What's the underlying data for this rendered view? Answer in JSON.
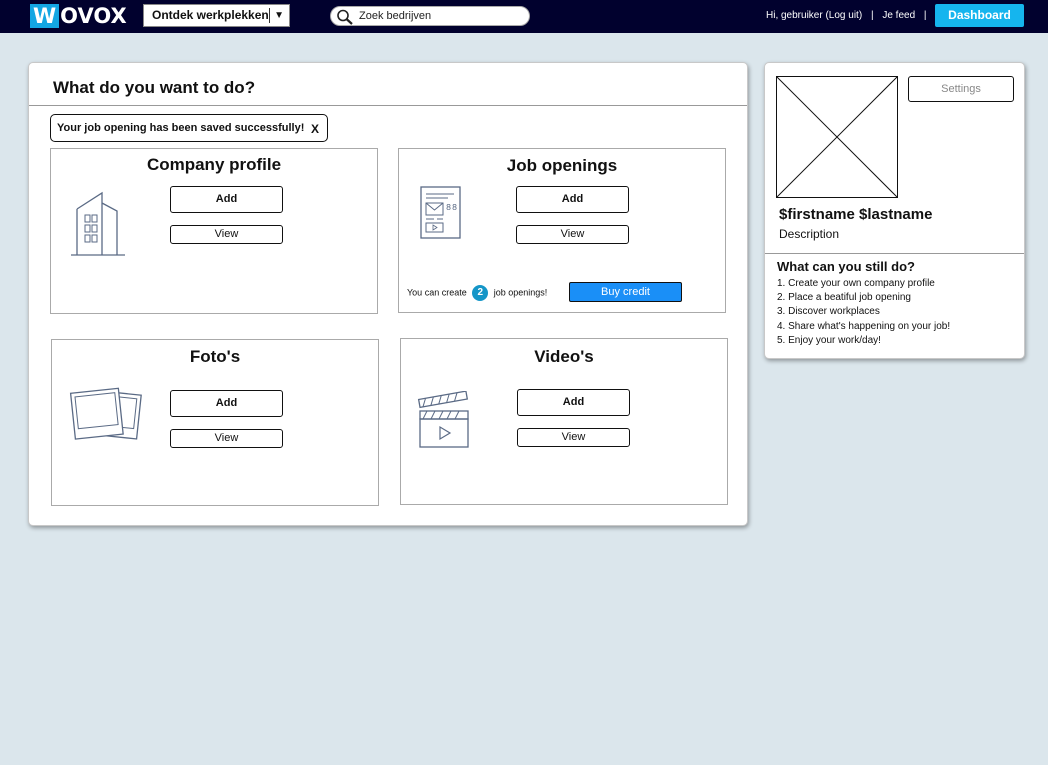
{
  "topbar": {
    "logo_mark": "W",
    "logo_rest": "OVOX",
    "explore_label": "Ontdek werkplekken",
    "explore_caret": "▼",
    "search_placeholder": "Zoek bedrijven",
    "greeting": "Hi, gebruiker (Log uit)",
    "separator": "|",
    "feed_link": "Je feed",
    "dashboard_label": "Dashboard"
  },
  "main": {
    "title": "What do you want to do?",
    "alert": {
      "message": "Your job opening has been saved successfully!",
      "close": "X"
    },
    "cards": {
      "company": {
        "title": "Company profile",
        "add": "Add",
        "view": "View"
      },
      "jobs": {
        "title": "Job openings",
        "add": "Add",
        "view": "View",
        "credit_prefix": "You can create",
        "credit_count": "2",
        "credit_suffix": "job openings!",
        "buy": "Buy credit"
      },
      "fotos": {
        "title": "Foto's",
        "add": "Add",
        "view": "View"
      },
      "videos": {
        "title": "Video's",
        "add": "Add",
        "view": "View"
      }
    }
  },
  "sidebar": {
    "settings_label": "Settings",
    "name": "$firstname $lastname",
    "description": "Description",
    "todo_title": "What can you still do?",
    "todo": [
      "1. Create your own company profile",
      "2. Place a beatiful job opening",
      "3. Discover workplaces",
      "4. Share what's happening on your job!",
      "5. Enjoy your work/day!"
    ]
  },
  "colors": {
    "topbar": "#01012e",
    "accent": "#15b5ee",
    "buy_button": "#1a8ff7",
    "background": "#dbe6ec"
  },
  "icons": [
    "search-icon",
    "building-icon",
    "job-document-icon",
    "photos-icon",
    "clapperboard-icon",
    "image-placeholder-icon"
  ]
}
